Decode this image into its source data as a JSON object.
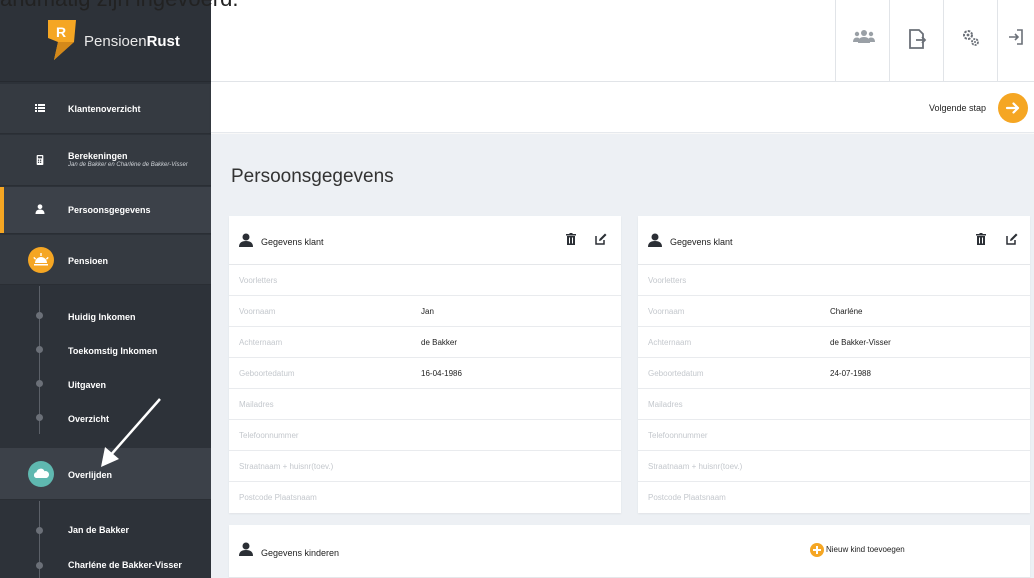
{
  "caption": "andmatig zijn ingevoerd.",
  "app": {
    "name_regular": "Pensioen",
    "name_bold": "Rust"
  },
  "sidebar": {
    "items": [
      {
        "label": "Klantenoverzicht",
        "icon": "list-icon"
      },
      {
        "label": "Berekeningen",
        "sublabel": "Jan de Bakker en Charléne de Bakker-Visser",
        "icon": "calculator-icon"
      },
      {
        "label": "Persoonsgegevens",
        "icon": "person-icon",
        "active": true
      },
      {
        "label": "Pensioen",
        "icon": "sunset-icon"
      },
      {
        "label": "Overlijden",
        "icon": "cloud-icon"
      }
    ],
    "pensioen_sub": [
      "Huidig Inkomen",
      "Toekomstig Inkomen",
      "Uitgaven",
      "Overzicht"
    ],
    "overlijden_sub": [
      "Jan de Bakker",
      "Charléne de Bakker-Visser"
    ]
  },
  "topbar": {
    "icons": [
      "users-icon",
      "export-icon",
      "settings-icon",
      "logout-icon"
    ]
  },
  "actionbar": {
    "next_label": "Volgende stap"
  },
  "main": {
    "title": "Persoonsgegevens",
    "cards": [
      {
        "title": "Gegevens klant",
        "fields": [
          {
            "label": "Voorletters",
            "value": ""
          },
          {
            "label": "Voornaam",
            "value": "Jan"
          },
          {
            "label": "Achternaam",
            "value": "de Bakker"
          },
          {
            "label": "Geboortedatum",
            "value": "16-04-1986"
          },
          {
            "label": "Mailadres",
            "value": ""
          },
          {
            "label": "Telefoonnummer",
            "value": ""
          },
          {
            "label": "Straatnaam + huisnr(toev.)",
            "value": ""
          },
          {
            "label": "Postcode Plaatsnaam",
            "value": ""
          }
        ]
      },
      {
        "title": "Gegevens klant",
        "fields": [
          {
            "label": "Voorletters",
            "value": ""
          },
          {
            "label": "Voornaam",
            "value": "Charléne"
          },
          {
            "label": "Achternaam",
            "value": "de Bakker-Visser"
          },
          {
            "label": "Geboortedatum",
            "value": "24-07-1988"
          },
          {
            "label": "Mailadres",
            "value": ""
          },
          {
            "label": "Telefoonnummer",
            "value": ""
          },
          {
            "label": "Straatnaam + huisnr(toev.)",
            "value": ""
          },
          {
            "label": "Postcode Plaatsnaam",
            "value": ""
          }
        ]
      }
    ],
    "children_card": {
      "title": "Gegevens kinderen",
      "add_label": "Nieuw kind toevoegen"
    }
  },
  "colors": {
    "accent": "#f5a623",
    "sidebar": "#2d3239",
    "overlijden_icon": "#5fb8b0"
  }
}
